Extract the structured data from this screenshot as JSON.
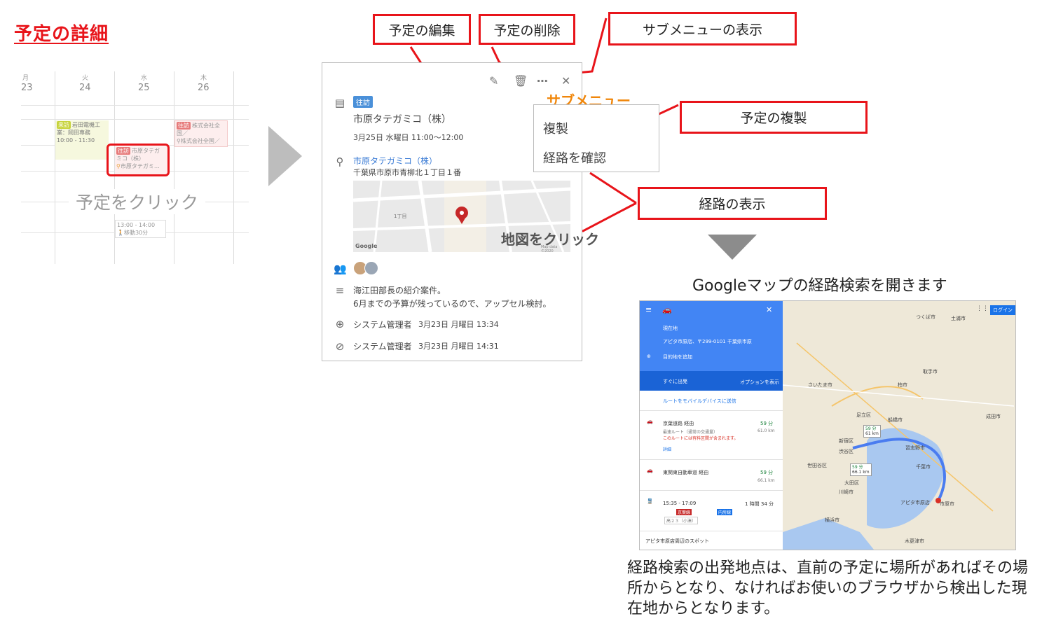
{
  "title": "予定の詳細",
  "calendar": {
    "days": [
      {
        "dow": "月",
        "num": "23"
      },
      {
        "dow": "火",
        "num": "24"
      },
      {
        "dow": "水",
        "num": "25"
      },
      {
        "dow": "木",
        "num": "26"
      }
    ],
    "event1": {
      "tag": "来訪",
      "line1": "岩田電機工",
      "line2": "業：岡田専務",
      "time": "10:00 - 11:30"
    },
    "event2": {
      "tag": "往訪",
      "line1": "市原タテガ",
      "line2": "ミコ（株）",
      "place": "市原タテガミ…"
    },
    "event3": {
      "tag": "往訪",
      "line1": "株式会社全",
      "line2": "国／",
      "place": "株式会社全国／"
    },
    "event4": {
      "time": "13:00 - 14:00",
      "move": "移動30分"
    },
    "hint": "予定をクリック"
  },
  "callouts": {
    "edit": "予定の編集",
    "delete": "予定の削除",
    "submenu_show": "サブメニューの表示",
    "duplicate": "予定の複製",
    "route_show": "経路の表示"
  },
  "popup": {
    "tag": "往訪",
    "company": "市原タテガミコ（株）",
    "datetime": "3月25日 水曜日 11:00～12:00",
    "location_name": "市原タテガミコ（株）",
    "address": "千葉県市原市青柳北１丁目１番",
    "map_brand": "Google",
    "map_credit": "Map data ©2020",
    "map_label": "1丁目",
    "desc1": "海江田部長の紹介案件。",
    "desc2": "6月までの予算が残っているので、アップセル検討。",
    "created_by": "システム管理者",
    "created_at": "3月23日 月曜日 13:34",
    "updated_by": "システム管理者",
    "updated_at": "3月23日 月曜日 14:31"
  },
  "submenu": {
    "label": "サブメニュー",
    "items": [
      "複製",
      "経路を確認"
    ]
  },
  "map_hint": "地図をクリック",
  "gm_caption": "Googleマップの経路検索を開きます",
  "gmaps": {
    "origin": "現在地",
    "destination": "アピタ市原店、〒299-0101 千葉県市原",
    "add_dest": "目的地を追加",
    "depart": "すぐに出発",
    "options": "オプションを表示",
    "send": "ルートをモバイルデバイスに送信",
    "route1": {
      "name": "京葉道路 経由",
      "time": "59 分",
      "dist": "61.0 km",
      "sub": "最速ルート（通常の交通量）",
      "warn": "このルートには有料区間が含まれます。",
      "detail": "詳細"
    },
    "route2": {
      "name": "東関東自動車道 経由",
      "time": "59 分",
      "dist": "66.1 km"
    },
    "route3": {
      "time": "15:35 - 17:09",
      "duration": "1 時間 34 分",
      "line1": "京葉線",
      "line2": "内房線",
      "stop": "高２３（小湊）"
    },
    "spots": "アピタ市原店周辺のスポット",
    "login": "ログイン",
    "map_labels": [
      "さいたま市",
      "船橋市",
      "千葉市",
      "川崎市",
      "横浜市",
      "新宿区",
      "渋谷区",
      "世田谷区",
      "大田区",
      "足立区",
      "柏市",
      "つくば市",
      "土浦市",
      "市原市",
      "木更津市",
      "アピタ市原店",
      "習志野市",
      "成田市",
      "取手市"
    ],
    "bubble1": "59 分",
    "bubble1_km": "61 km",
    "bubble2": "59 分",
    "bubble2_km": "66.1 km"
  },
  "footer": "経路検索の出発地点は、直前の予定に場所があればその場所からとなり、なければお使いのブラウザから検出した現在地からとなります。"
}
